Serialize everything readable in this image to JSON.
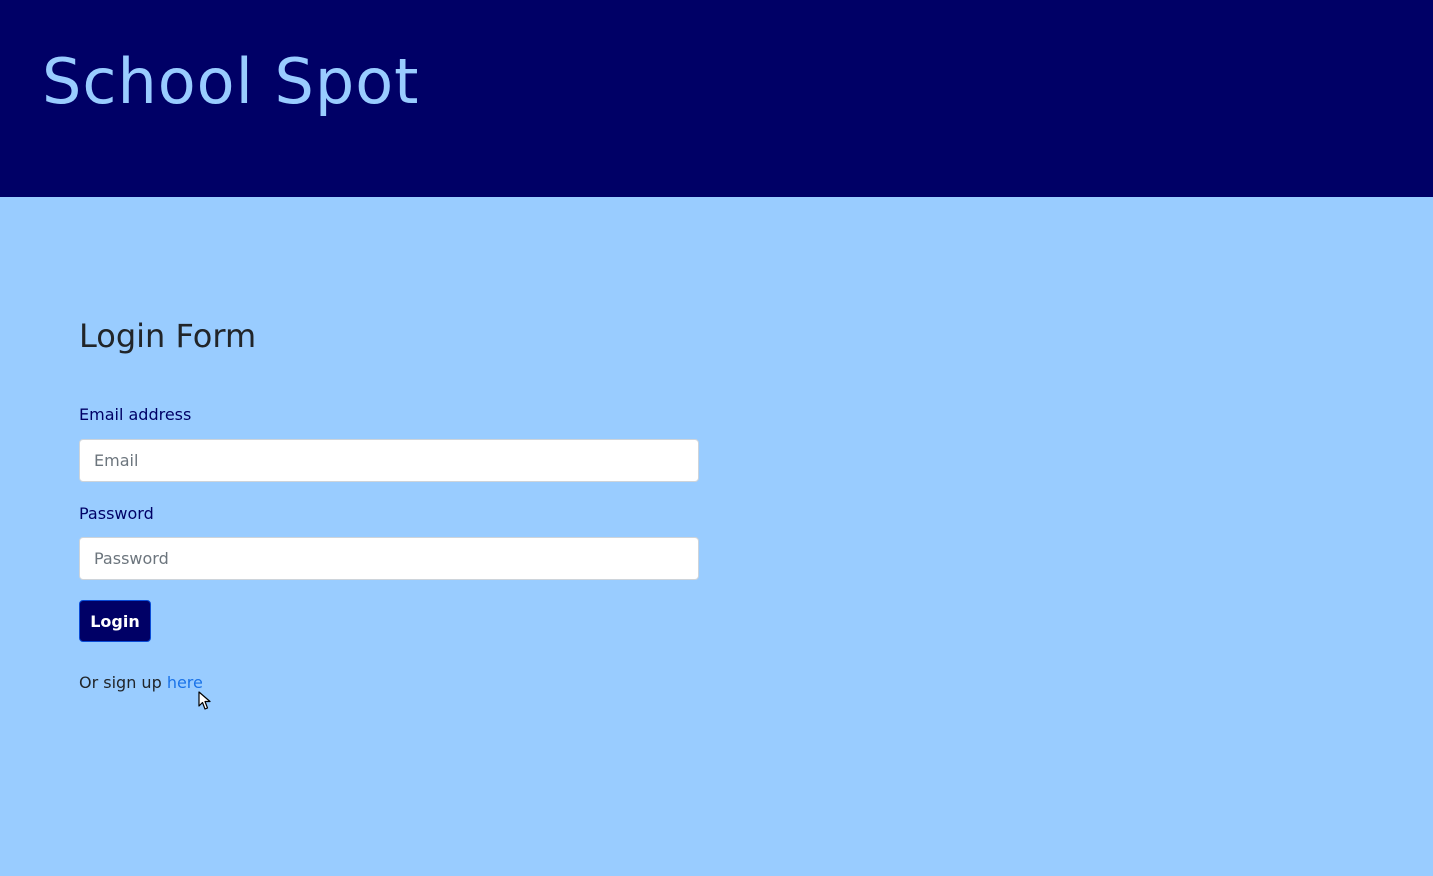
{
  "header": {
    "brand": "School Spot",
    "background_color": "#000066",
    "brand_color": "#99ccff"
  },
  "page": {
    "background_color": "#99ccff"
  },
  "form": {
    "title": "Login Form",
    "email": {
      "label": "Email address",
      "placeholder": "Email",
      "value": ""
    },
    "password": {
      "label": "Password",
      "placeholder": "Password",
      "value": ""
    },
    "submit_label": "Login",
    "submit_color": "#000066"
  },
  "signup": {
    "prefix": "Or sign up ",
    "link_text": "here",
    "link_color": "#1a73e8"
  },
  "cursor": {
    "icon": "mouse-pointer-icon"
  }
}
